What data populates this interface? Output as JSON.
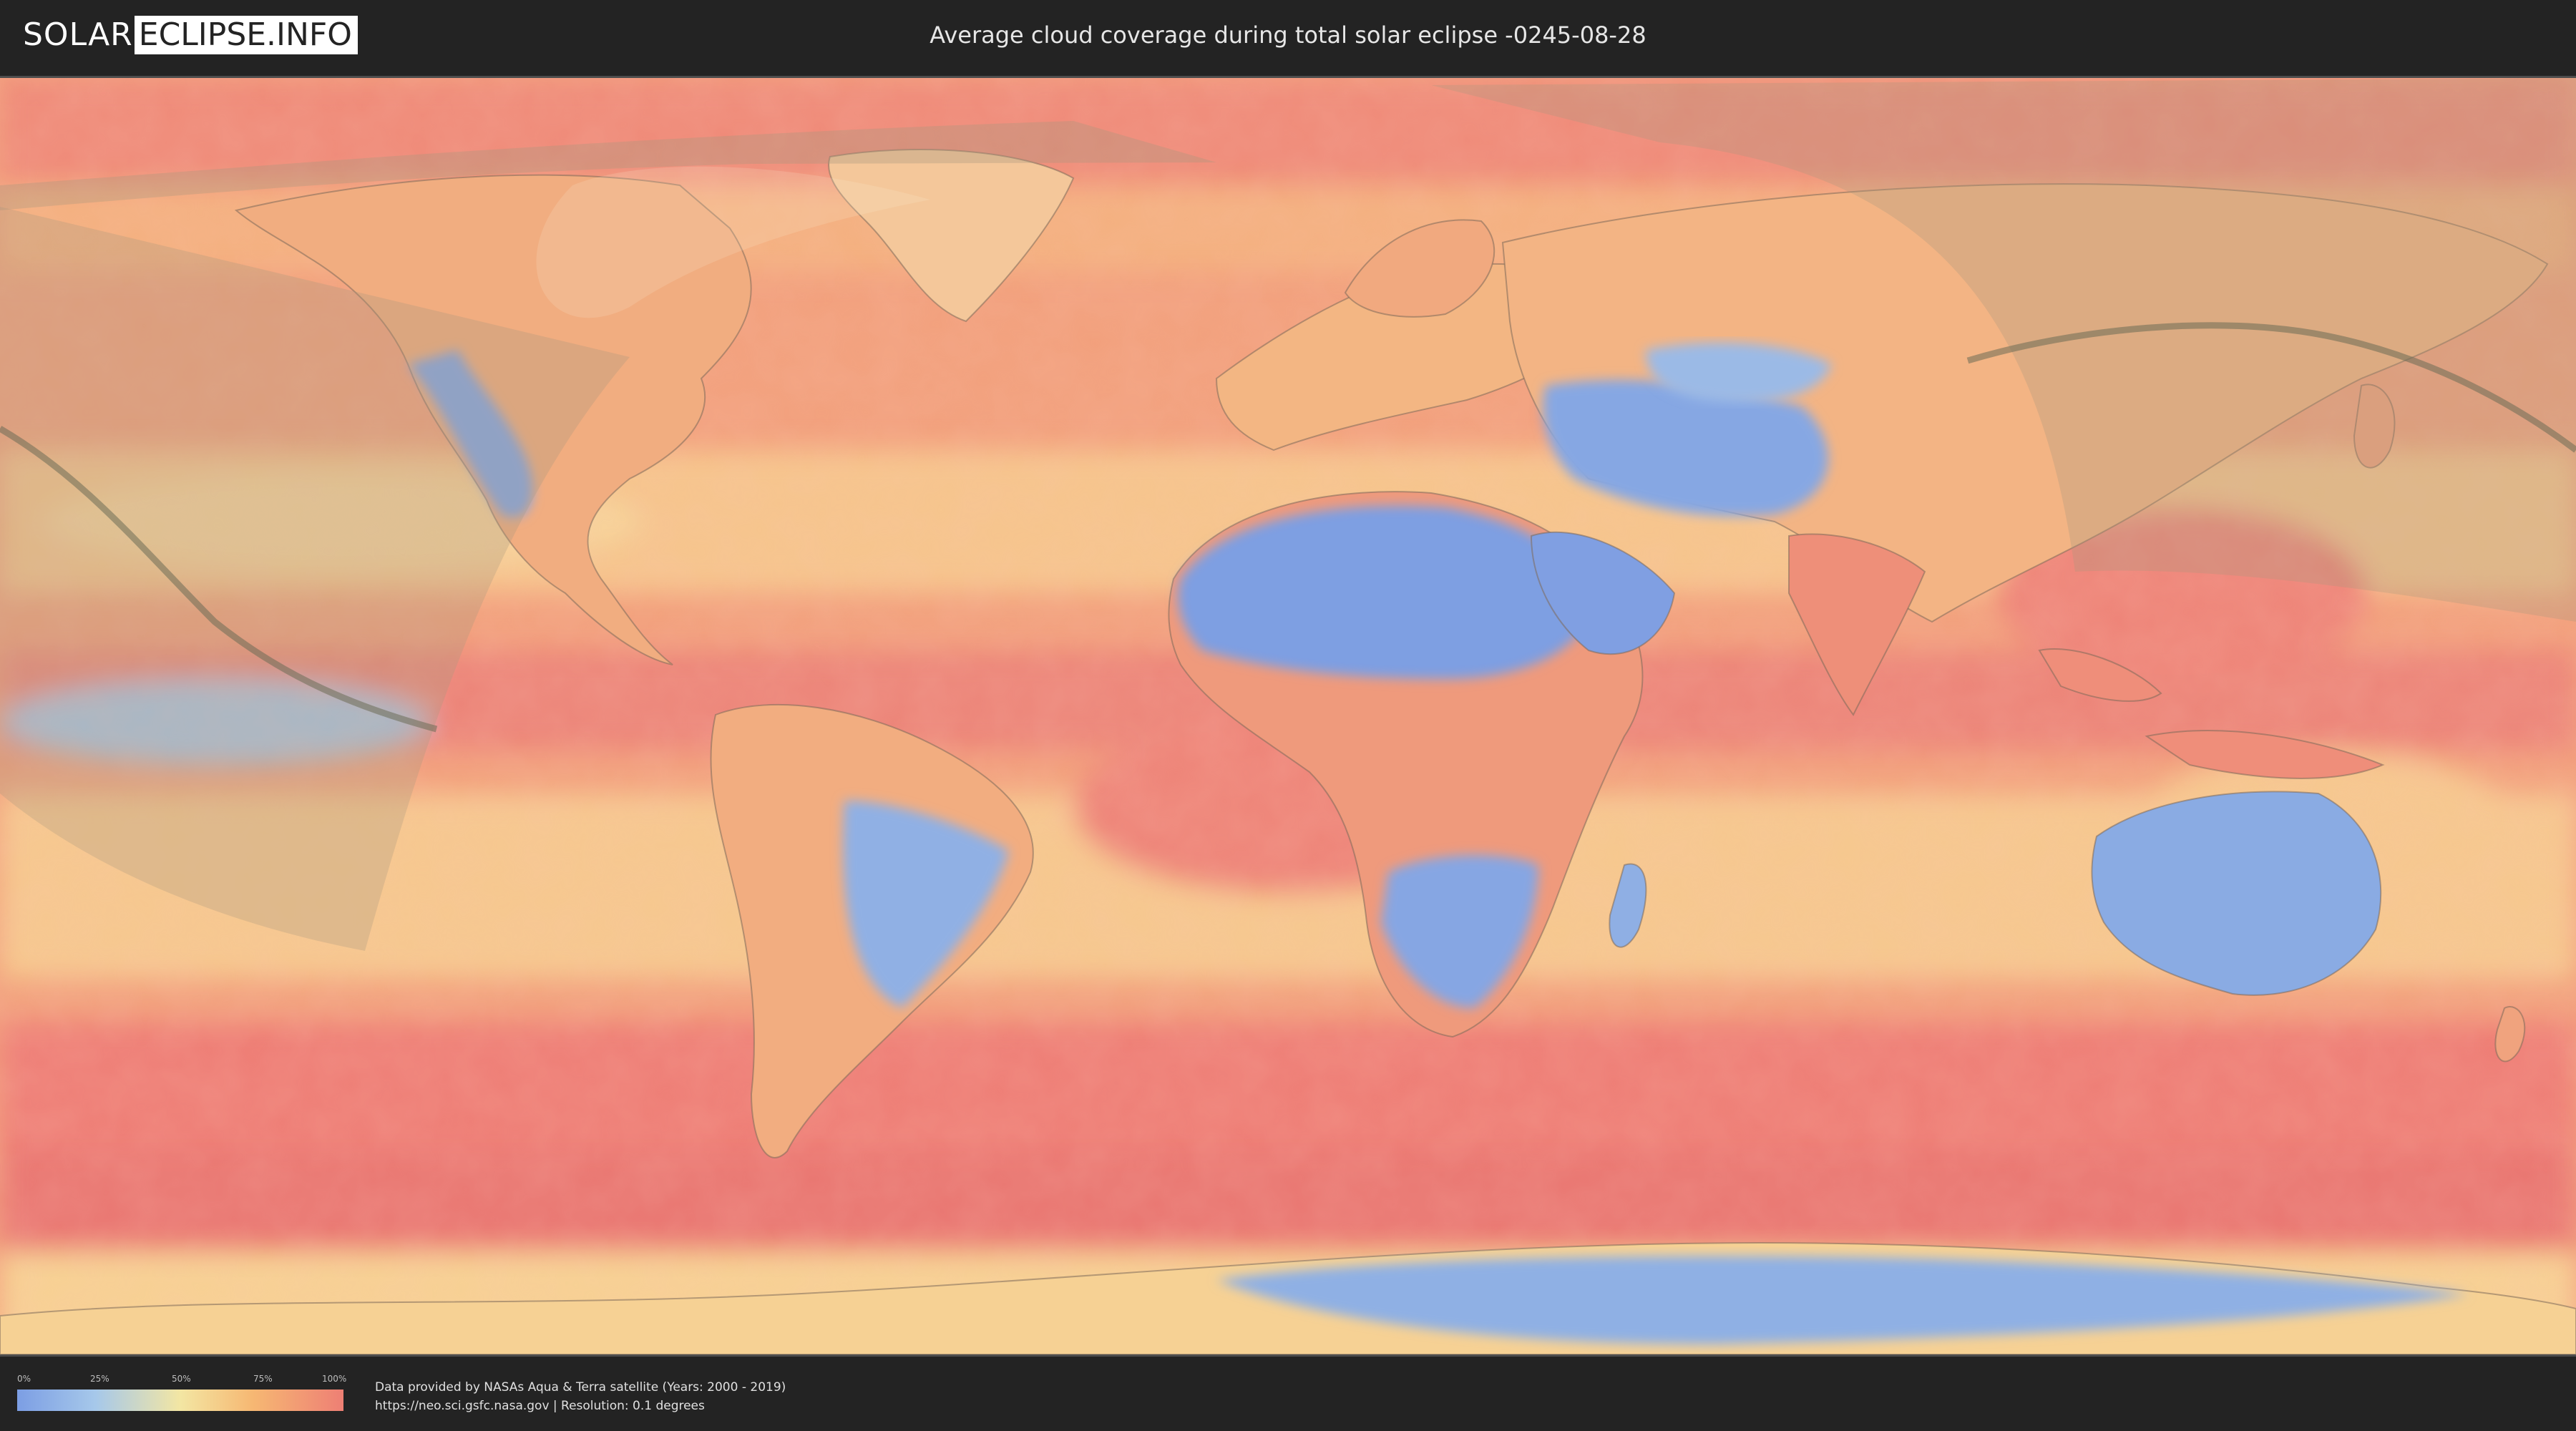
{
  "header": {
    "logo_left": "SOLAR",
    "logo_right": "ECLIPSE.INFO",
    "title": "Average cloud coverage during total solar eclipse -0245-08-28"
  },
  "legend": {
    "ticks": [
      "0%",
      "25%",
      "50%",
      "75%",
      "100%"
    ],
    "colors": [
      "#7c9ee4",
      "#a6c8ea",
      "#f3e6a3",
      "#f6b873",
      "#ee7f74"
    ]
  },
  "credit": {
    "line1": "Data provided by NASAs Aqua & Terra satellite (Years: 2000 - 2019)",
    "line2": "https://neo.sci.gsfc.nasa.gov | Resolution: 0.1 degrees"
  },
  "map": {
    "layer": "average cloud coverage",
    "projection": "equirectangular world",
    "totality_path_color": "#6b6b55",
    "night_overlay_color": "#b4a58c"
  }
}
